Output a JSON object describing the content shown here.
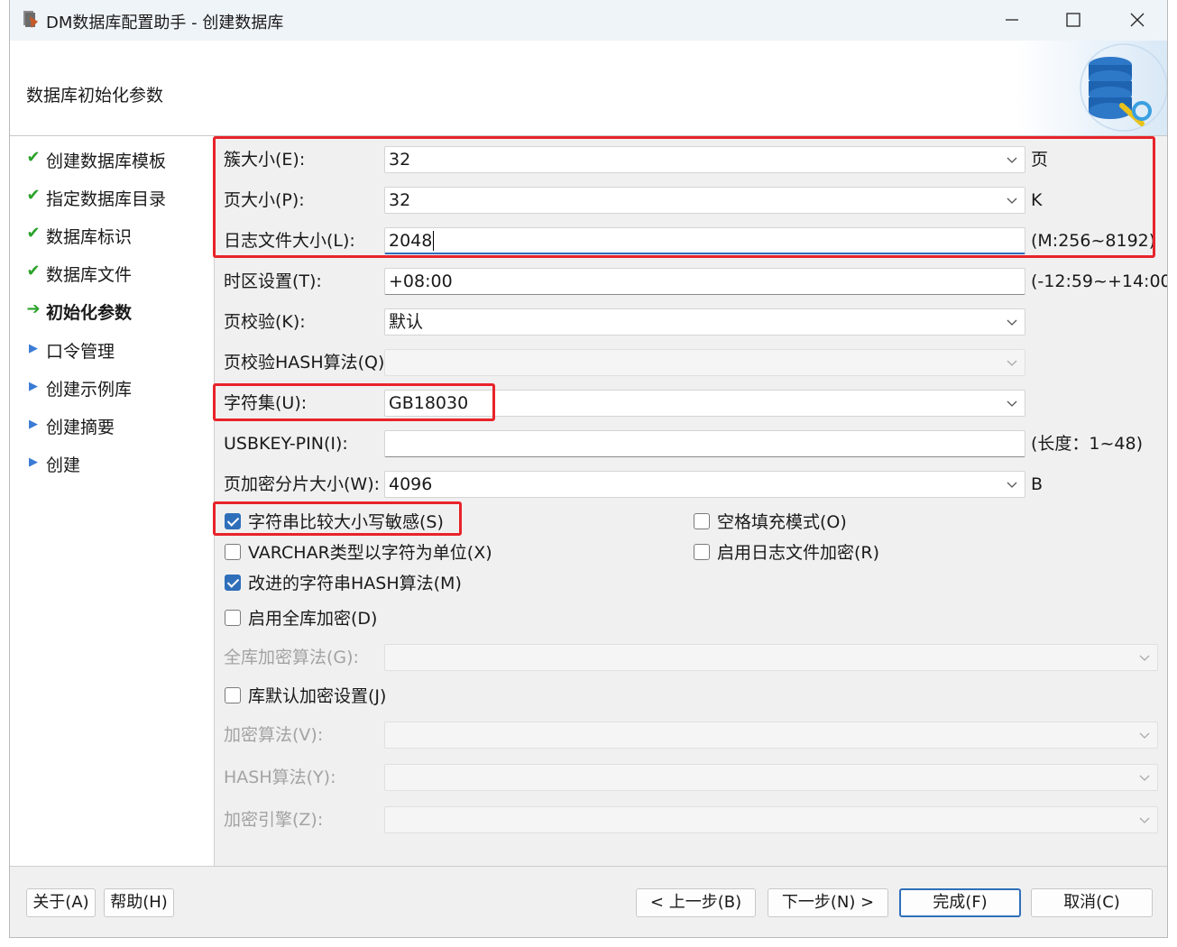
{
  "window": {
    "title": "DM数据库配置助手 - 创建数据库",
    "caption_buttons": [
      "minimize-icon",
      "maximize-icon",
      "close-icon"
    ]
  },
  "header": {
    "title": "数据库初始化参数",
    "art_icon": "database-settings-icon"
  },
  "sidebar": {
    "items": [
      {
        "label": "创建数据库模板",
        "state": "done"
      },
      {
        "label": "指定数据库目录",
        "state": "done"
      },
      {
        "label": "数据库标识",
        "state": "done"
      },
      {
        "label": "数据库文件",
        "state": "done"
      },
      {
        "label": "初始化参数",
        "state": "current"
      },
      {
        "label": "口令管理",
        "state": "pending"
      },
      {
        "label": "创建示例库",
        "state": "pending"
      },
      {
        "label": "创建摘要",
        "state": "pending"
      },
      {
        "label": "创建",
        "state": "pending"
      }
    ]
  },
  "form": {
    "extent_size": {
      "label": "簇大小(E):",
      "value": "32",
      "unit": "页"
    },
    "page_size": {
      "label": "页大小(P):",
      "value": "32",
      "unit": "K"
    },
    "log_size": {
      "label": "日志文件大小(L):",
      "value": "2048",
      "unit": "(M:256~8192)"
    },
    "time_zone": {
      "label": "时区设置(T):",
      "value": "+08:00",
      "unit": "(-12:59~+14:00)"
    },
    "page_check": {
      "label": "页校验(K):",
      "value": "默认"
    },
    "page_check_hash": {
      "label": "页校验HASH算法(Q):",
      "value": ""
    },
    "charset": {
      "label": "字符集(U):",
      "value": "GB18030"
    },
    "usbkey_pin": {
      "label": "USBKEY-PIN(I):",
      "value": "",
      "unit": "(长度：1~48)"
    },
    "page_enc_slice": {
      "label": "页加密分片大小(W):",
      "value": "4096",
      "unit": "B"
    },
    "checkboxes": {
      "case_sensitive": {
        "label": "字符串比较大小写敏感(S)",
        "checked": true
      },
      "blank_pad": {
        "label": "空格填充模式(O)",
        "checked": false
      },
      "varchar_char": {
        "label": "VARCHAR类型以字符为单位(X)",
        "checked": false
      },
      "log_encrypt": {
        "label": "启用日志文件加密(R)",
        "checked": false
      },
      "improved_hash": {
        "label": "改进的字符串HASH算法(M)",
        "checked": true
      },
      "full_encrypt": {
        "label": "启用全库加密(D)",
        "checked": false
      },
      "default_encrypt": {
        "label": "库默认加密设置(J)",
        "checked": false
      }
    },
    "full_enc_algo": {
      "label": "全库加密算法(G):",
      "value": ""
    },
    "enc_algo": {
      "label": "加密算法(V):",
      "value": ""
    },
    "hash_algo": {
      "label": "HASH算法(Y):",
      "value": ""
    },
    "enc_engine": {
      "label": "加密引擎(Z):",
      "value": ""
    }
  },
  "footer": {
    "about": "关于(A)",
    "help": "帮助(H)",
    "prev": "< 上一步(B)",
    "next": "下一步(N) >",
    "finish": "完成(F)",
    "cancel": "取消(C)"
  },
  "colors": {
    "highlight": "#e8232a",
    "accent": "#2f6fba",
    "done_check": "#2aa22a"
  }
}
